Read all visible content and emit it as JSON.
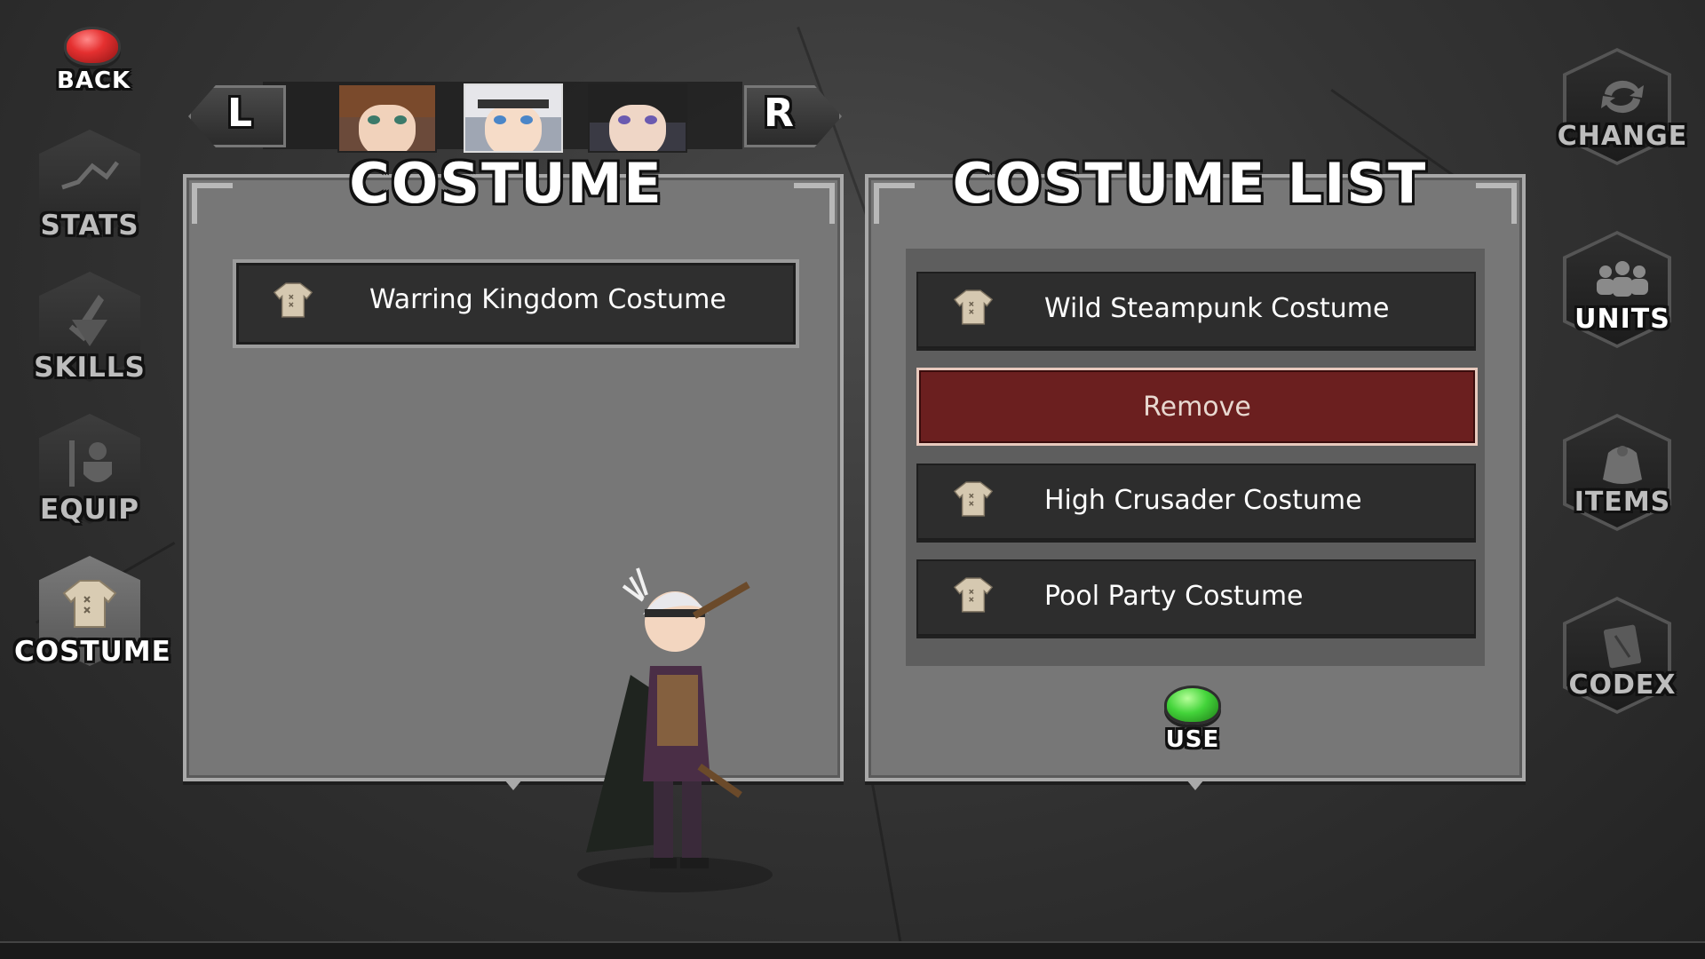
{
  "top": {
    "back_label": "BACK",
    "left_arrow_label": "L",
    "right_arrow_label": "R"
  },
  "left_nav": [
    {
      "label": "STATS",
      "icon": "chart-icon",
      "active": false
    },
    {
      "label": "SKILLS",
      "icon": "sword-icon",
      "active": false
    },
    {
      "label": "EQUIP",
      "icon": "helmet-shield-icon",
      "active": false
    },
    {
      "label": "COSTUME",
      "icon": "costume-icon",
      "active": true
    }
  ],
  "right_nav": [
    {
      "label": "CHANGE",
      "icon": "refresh-icon"
    },
    {
      "label": "UNITS",
      "icon": "group-icon"
    },
    {
      "label": "ITEMS",
      "icon": "bag-icon"
    },
    {
      "label": "CODEX",
      "icon": "book-icon"
    }
  ],
  "costume_panel": {
    "title": "COSTUME",
    "equipped": "Warring Kingdom Costume"
  },
  "costume_list_panel": {
    "title": "COSTUME LIST",
    "items": [
      {
        "label": "Wild Steampunk Costume",
        "type": "costume"
      },
      {
        "label": "Remove",
        "type": "remove"
      },
      {
        "label": "High Crusader Costume",
        "type": "costume"
      },
      {
        "label": "Pool Party Costume",
        "type": "costume"
      }
    ],
    "use_label": "USE"
  },
  "colors": {
    "panel_bg": "#777777",
    "remove_bg": "#6b1f1f",
    "back_button": "#e53030",
    "use_button": "#43d43a"
  }
}
